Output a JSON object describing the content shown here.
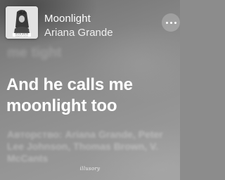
{
  "now_playing": {
    "title": "Moonlight",
    "artist": "Ariana Grande",
    "album_art": {
      "label": "ariana grande",
      "sublabel": "dangerous woman",
      "icon": "album-art-icon"
    },
    "more_icon": "ellipsis-icon"
  },
  "lyrics": {
    "previous_line": "me tight",
    "current_line": "And he calls me moonlight too",
    "credits": "Авторство: Ariana Grande, Peter Lee Johnson, Thomas Brown, V. McCants"
  },
  "watermark": "illusory",
  "colors": {
    "background": "#8c8c8c",
    "text": "#ffffff",
    "album_bg": "#dcdcdc"
  }
}
